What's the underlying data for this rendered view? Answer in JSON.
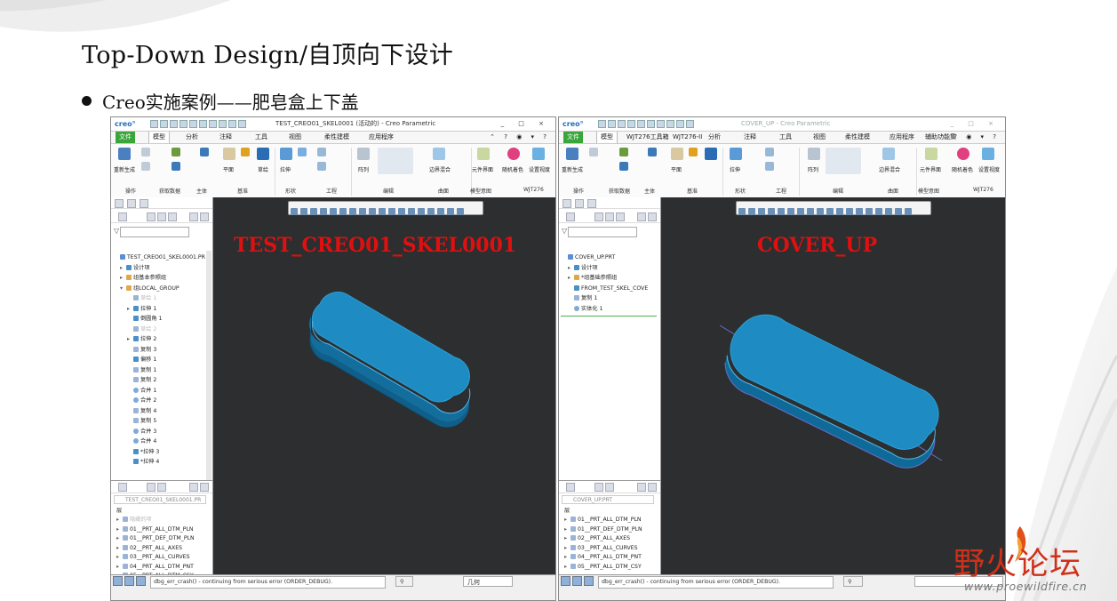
{
  "slide": {
    "title": "Top-Down Design/自顶向下设计",
    "bullet": "Creo实施案例——肥皂盒上下盖"
  },
  "left_window": {
    "logo": "creo°",
    "window_title": "TEST_CREO01_SKEL0001 (活动的) - Creo Parametric",
    "window_controls": "_ □ ×",
    "menu_tabs": [
      "文件",
      "模型",
      "分析",
      "注释",
      "工具",
      "视图",
      "柔性建模",
      "应用程序"
    ],
    "menu_right": "⌃ ? ◉ ▾ ?",
    "ribbon_labels": [
      "重新生成",
      "平面",
      "草绘",
      "拉伸",
      "阵列",
      "边界混合",
      "元件界面",
      "随机着色",
      "设置视度"
    ],
    "ribbon_groups": [
      "操作",
      "获取数据",
      "主体",
      "基准",
      "形状",
      "工程",
      "编辑",
      "曲面",
      "模型意图",
      "WJT276"
    ],
    "filter_icon": "▽",
    "tree_items": [
      {
        "label": "TEST_CREO01_SKEL0001.PR",
        "dim": false,
        "arrow": "",
        "icon": "part"
      },
      {
        "label": "设计项",
        "dim": false,
        "arrow": "▸",
        "icon": "feat"
      },
      {
        "label": "组基本参照组",
        "dim": false,
        "arrow": "▸",
        "icon": "grp"
      },
      {
        "label": "组LOCAL_GROUP",
        "dim": false,
        "arrow": "▾",
        "icon": "grp"
      },
      {
        "label": "草绘 1",
        "dim": true,
        "arrow": "",
        "icon": "copy"
      },
      {
        "label": "拉伸 1",
        "dim": false,
        "arrow": "▸",
        "icon": "feat"
      },
      {
        "label": "倒圆角 1",
        "dim": false,
        "arrow": "",
        "icon": "feat"
      },
      {
        "label": "草绘 2",
        "dim": true,
        "arrow": "",
        "icon": "copy"
      },
      {
        "label": "拉伸 2",
        "dim": false,
        "arrow": "▸",
        "icon": "feat"
      },
      {
        "label": "复制 3",
        "dim": false,
        "arrow": "",
        "icon": "copy"
      },
      {
        "label": "偏移 1",
        "dim": false,
        "arrow": "",
        "icon": "feat"
      },
      {
        "label": "复制 1",
        "dim": false,
        "arrow": "",
        "icon": "copy"
      },
      {
        "label": "复制 2",
        "dim": false,
        "arrow": "",
        "icon": "copy"
      },
      {
        "label": "合并 1",
        "dim": false,
        "arrow": "",
        "icon": "merge"
      },
      {
        "label": "合并 2",
        "dim": false,
        "arrow": "",
        "icon": "merge"
      },
      {
        "label": "复制 4",
        "dim": false,
        "arrow": "",
        "icon": "copy"
      },
      {
        "label": "复制 5",
        "dim": false,
        "arrow": "",
        "icon": "copy"
      },
      {
        "label": "合并 3",
        "dim": false,
        "arrow": "",
        "icon": "merge"
      },
      {
        "label": "合并 4",
        "dim": false,
        "arrow": "",
        "icon": "merge"
      },
      {
        "label": "*拉伸 3",
        "dim": false,
        "arrow": "",
        "icon": "feat"
      },
      {
        "label": "*拉伸 4",
        "dim": false,
        "arrow": "",
        "icon": "feat"
      }
    ],
    "layer_path": "TEST_CREO01_SKEL0001.PR",
    "layer_header": "层",
    "layer_items": [
      "隐藏的项",
      "01__PRT_ALL_DTM_PLN",
      "01__PRT_DEF_DTM_PLN",
      "02__PRT_ALL_AXES",
      "03__PRT_ALL_CURVES",
      "04__PRT_ALL_DTM_PNT",
      "05__PRT_ALL_DTM_CSY"
    ],
    "model_name": "TEST_CREO01_SKEL0001",
    "status_message": "dbg_err_crash() - continuing from serious error (ORDER_DEBUG).",
    "selection_filter": "几何"
  },
  "right_window": {
    "logo": "creo°",
    "window_title": "COVER_UP - Creo Parametric",
    "window_controls": "_ □ ×",
    "menu_tabs": [
      "文件",
      "模型",
      "WJT276工具箱",
      "WJT276-II",
      "分析",
      "注释",
      "工具",
      "视图",
      "柔性建模",
      "应用程序",
      "辅助功能集"
    ],
    "menu_right": "⌃ ? ◉ ▾ ?",
    "ribbon_labels": [
      "重新生成",
      "平面",
      "拉伸",
      "阵列",
      "边界混合",
      "元件界面",
      "随机着色",
      "设置视度"
    ],
    "ribbon_groups": [
      "操作",
      "获取数据",
      "主体",
      "基准",
      "形状",
      "工程",
      "编辑",
      "曲面",
      "模型意图",
      "WJT276"
    ],
    "filter_icon": "▽",
    "tree_items": [
      {
        "label": "COVER_UP.PRT",
        "dim": false,
        "arrow": "",
        "icon": "part"
      },
      {
        "label": "设计项",
        "dim": false,
        "arrow": "▸",
        "icon": "feat"
      },
      {
        "label": "*组基础参照组",
        "dim": false,
        "arrow": "▸",
        "icon": "grp"
      },
      {
        "label": "FROM_TEST_SKEL_COVE",
        "dim": false,
        "arrow": "",
        "icon": "feat"
      },
      {
        "label": "复制 1",
        "dim": false,
        "arrow": "",
        "icon": "copy"
      },
      {
        "label": "实体化 1",
        "dim": false,
        "arrow": "",
        "icon": "merge"
      }
    ],
    "layer_path": "COVER_UP.PRT",
    "layer_header": "层",
    "layer_items": [
      "01__PRT_ALL_DTM_PLN",
      "01__PRT_DEF_DTM_PLN",
      "02__PRT_ALL_AXES",
      "03__PRT_ALL_CURVES",
      "04__PRT_ALL_DTM_PNT",
      "05__PRT_ALL_DTM_CSY"
    ],
    "model_name": "COVER_UP",
    "status_message": "dbg_err_crash() - continuing from serious error (ORDER_DEBUG).",
    "selection_filter": ""
  },
  "watermark": {
    "cn": "野火论坛",
    "url": "www.proewildfire.cn"
  },
  "colors": {
    "model_blue": "#1e8bc3",
    "model_name_red": "#e01010",
    "viewport_bg": "#2c2e30",
    "file_tab_green": "#3aa53a"
  }
}
